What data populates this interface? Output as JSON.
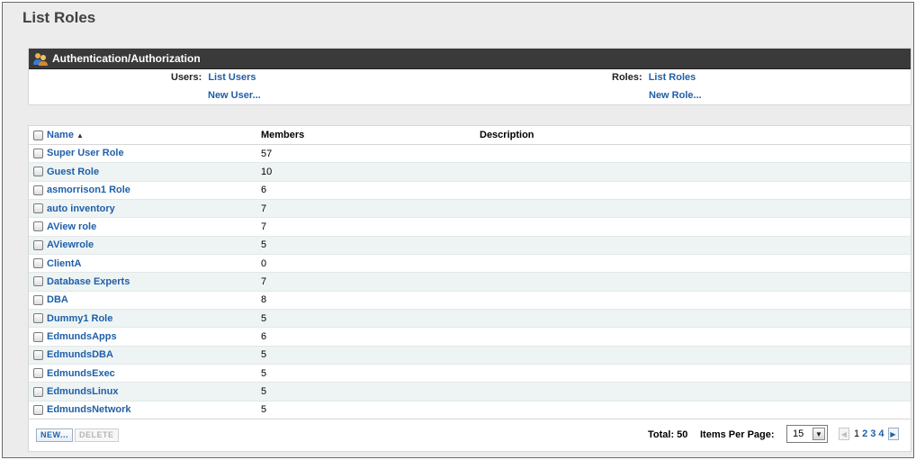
{
  "page": {
    "title": "List Roles"
  },
  "auth": {
    "header": "Authentication/Authorization",
    "users_label": "Users:",
    "list_users": "List Users",
    "new_user": "New User...",
    "roles_label": "Roles:",
    "list_roles": "List Roles",
    "new_role": "New Role..."
  },
  "table": {
    "columns": {
      "name": "Name",
      "members": "Members",
      "description": "Description"
    },
    "sort_indicator": "▲",
    "rows": [
      {
        "name": "Super User Role",
        "members": "57"
      },
      {
        "name": "Guest Role",
        "members": "10"
      },
      {
        "name": "asmorrison1 Role",
        "members": "6"
      },
      {
        "name": "auto inventory",
        "members": "7"
      },
      {
        "name": "AView role",
        "members": "7"
      },
      {
        "name": "AViewrole",
        "members": "5"
      },
      {
        "name": "ClientA",
        "members": "0"
      },
      {
        "name": "Database Experts",
        "members": "7"
      },
      {
        "name": "DBA",
        "members": "8"
      },
      {
        "name": "Dummy1 Role",
        "members": "5"
      },
      {
        "name": "EdmundsApps",
        "members": "6"
      },
      {
        "name": "EdmundsDBA",
        "members": "5"
      },
      {
        "name": "EdmundsExec",
        "members": "5"
      },
      {
        "name": "EdmundsLinux",
        "members": "5"
      },
      {
        "name": "EdmundsNetwork",
        "members": "5"
      }
    ]
  },
  "footer": {
    "new_button": "NEW...",
    "delete_button": "DELETE",
    "total": "Total: 50",
    "items_per_page_label": "Items Per Page:",
    "items_per_page_value": "15",
    "pages": [
      "1",
      "2",
      "3",
      "4"
    ],
    "current_page": "1"
  },
  "colors": {
    "link": "#1f5fa8",
    "header_bar": "#3a3a3a",
    "row_alt": "#eef4f4"
  }
}
